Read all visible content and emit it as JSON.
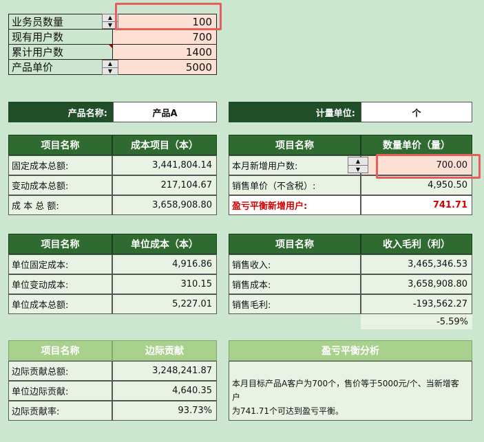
{
  "top_inputs": [
    {
      "label": "业务员数量",
      "value": "100"
    },
    {
      "label": "现有用户数",
      "value": "700"
    },
    {
      "label": "累计用户数",
      "value": "1400"
    },
    {
      "label": "产品单价",
      "value": "5000"
    }
  ],
  "product": {
    "name_label": "产品名称:",
    "name_value": "产品A",
    "unit_label": "计量单位:",
    "unit_value": "个"
  },
  "table_cost": {
    "headers": [
      "项目名称",
      "成本项目（本）"
    ],
    "rows": [
      {
        "label": "固定成本总额:",
        "value": "3,441,804.14"
      },
      {
        "label": "变动成本总额:",
        "value": "217,104.67"
      },
      {
        "label": "成 本 总 额:",
        "value": "3,658,908.80"
      }
    ]
  },
  "table_qty": {
    "headers": [
      "项目名称",
      "数量单价（量）"
    ],
    "rows": [
      {
        "label": "本月新增用户数:",
        "value": "700.00"
      },
      {
        "label": "销售单价（不含税）:",
        "value": "4,950.50"
      },
      {
        "label": "盈亏平衡新增用户:",
        "value": "741.71"
      }
    ]
  },
  "table_unit_cost": {
    "headers": [
      "项目名称",
      "单位成本（本）"
    ],
    "rows": [
      {
        "label": "单位固定成本:",
        "value": "4,916.86"
      },
      {
        "label": "单位变动成本:",
        "value": "310.15"
      },
      {
        "label": "单位成本总额:",
        "value": "5,227.01"
      }
    ]
  },
  "table_profit": {
    "headers": [
      "项目名称",
      "收入毛利（利）"
    ],
    "rows": [
      {
        "label": "销售收入:",
        "value": "3,465,346.53"
      },
      {
        "label": "销售成本:",
        "value": "3,658,908.80"
      },
      {
        "label": "销售毛利:",
        "value": "-193,562.27"
      }
    ],
    "extra": "-5.59%"
  },
  "table_margin": {
    "headers": [
      "项目名称",
      "边际贡献"
    ],
    "rows": [
      {
        "label": "边际贡献总额:",
        "value": "3,248,241.87"
      },
      {
        "label": "单位边际贡献:",
        "value": "4,640.35"
      },
      {
        "label": "边际贡献率:",
        "value": "93.73%"
      }
    ]
  },
  "analysis": {
    "title": "盈亏平衡分析",
    "line1": "本月目标产品A客户为700个，售价等于5000元/个、当新增客户",
    "line2": "为741.71个可达到盈亏平衡。"
  },
  "colors": {
    "header_dark": "#1f4e28",
    "header_mid": "#2f6b31",
    "header_light": "#a9d18e",
    "background": "#cde6cf",
    "highlight": "#e85c5c"
  }
}
